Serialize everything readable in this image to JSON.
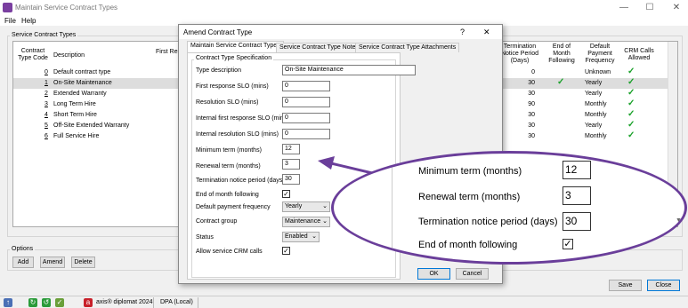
{
  "app": {
    "title": "Maintain Service Contract Types",
    "menu": [
      "File",
      "Help"
    ],
    "window_controls": [
      "—",
      "☐",
      "✕"
    ]
  },
  "main": {
    "group_label": "Service Contract Types",
    "columns": {
      "code": "Contract Type Code",
      "description": "Description",
      "first_resp": "First Resp",
      "term_notice": "Termination Notice Period (Days)",
      "end_of_month": "End of Month Following",
      "payment_freq": "Default Payment Frequency",
      "crm_calls": "CRM Calls Allowed"
    },
    "rows": [
      {
        "code": "0",
        "description": "Default contract type",
        "term_notice": "0",
        "end_of_month": false,
        "payment_freq": "Unknown",
        "crm": true,
        "selected": false
      },
      {
        "code": "1",
        "description": "On-Site Maintenance",
        "term_notice": "30",
        "end_of_month": true,
        "payment_freq": "Yearly",
        "crm": true,
        "selected": true
      },
      {
        "code": "2",
        "description": "Extended Warranty",
        "term_notice": "30",
        "end_of_month": false,
        "payment_freq": "Yearly",
        "crm": true,
        "selected": false
      },
      {
        "code": "3",
        "description": "Long Term Hire",
        "term_notice": "90",
        "end_of_month": false,
        "payment_freq": "Monthly",
        "crm": true,
        "selected": false
      },
      {
        "code": "4",
        "description": "Short Term Hire",
        "term_notice": "30",
        "end_of_month": false,
        "payment_freq": "Monthly",
        "crm": true,
        "selected": false
      },
      {
        "code": "5",
        "description": "Off-Site Extended Warranty",
        "term_notice": "30",
        "end_of_month": false,
        "payment_freq": "Yearly",
        "crm": true,
        "selected": false
      },
      {
        "code": "6",
        "description": "Full Service Hire",
        "term_notice": "30",
        "end_of_month": false,
        "payment_freq": "Monthly",
        "crm": true,
        "selected": false
      }
    ],
    "tick_glyph": "✓",
    "options_label": "Options",
    "buttons": {
      "add": "Add",
      "amend": "Amend",
      "delete": "Delete",
      "save": "Save",
      "close": "Close"
    }
  },
  "statusbar": {
    "product": "axis® diplomat 2024",
    "database": "DPA (Local)",
    "icons": [
      "up-arrow-icon",
      "refresh-icon",
      "refresh-alt-icon",
      "checklist-icon",
      "axis-logo-icon"
    ]
  },
  "dialog": {
    "title": "Amend Contract Type",
    "help": "?",
    "close": "✕",
    "tabs": [
      "Maintain Service Contract Types",
      "Service Contract Type Notes",
      "Service Contract Type Attachments"
    ],
    "section_label": "Contract Type Specification",
    "fields": {
      "type_description": {
        "label": "Type description",
        "value": "On-Site Maintenance"
      },
      "first_response_slo": {
        "label": "First response SLO (mins)",
        "value": "0"
      },
      "resolution_slo": {
        "label": "Resolution SLO (mins)",
        "value": "0"
      },
      "internal_first_response_slo": {
        "label": "Internal first response SLO (mins)",
        "value": "0"
      },
      "internal_resolution_slo": {
        "label": "Internal resolution SLO (mins)",
        "value": "0"
      },
      "minimum_term": {
        "label": "Minimum term (months)",
        "value": "12"
      },
      "renewal_term": {
        "label": "Renewal term (months)",
        "value": "3"
      },
      "termination_notice": {
        "label": "Termination notice period (days)",
        "value": "30"
      },
      "end_of_month": {
        "label": "End of month following",
        "checked": true
      },
      "payment_frequency": {
        "label": "Default payment frequency",
        "value": "Yearly"
      },
      "contract_group": {
        "label": "Contract group",
        "value": "Maintenance"
      },
      "status": {
        "label": "Status",
        "value": "Enabled"
      },
      "allow_crm": {
        "label": "Allow service CRM calls",
        "checked": true
      }
    },
    "buttons": {
      "ok": "OK",
      "cancel": "Cancel"
    }
  },
  "callout": {
    "minimum_term": {
      "label": "Minimum term (months)",
      "value": "12"
    },
    "renewal_term": {
      "label": "Renewal term (months)",
      "value": "3"
    },
    "termination_notice": {
      "label": "Termination notice period (days)",
      "value": "30"
    },
    "end_of_month": {
      "label": "End of month following",
      "checked": true
    },
    "accent": "#6a3e9a"
  }
}
